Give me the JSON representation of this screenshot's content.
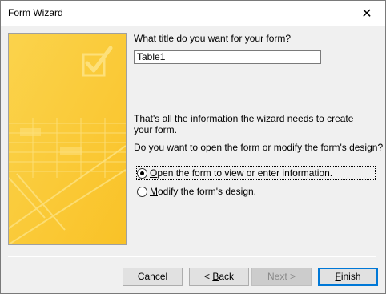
{
  "window": {
    "title": "Form Wizard",
    "close_label": "✕"
  },
  "form": {
    "question": "What title do you want for your form?",
    "title_value": "Table1",
    "info": "That's all the information the wizard needs to create your form.",
    "ask": "Do you want to open the form or modify the form's design?"
  },
  "options": [
    {
      "mnemonic": "O",
      "label_rest": "pen the form to view or enter information.",
      "selected": true
    },
    {
      "mnemonic": "M",
      "label_rest": "odify the form's design.",
      "selected": false
    }
  ],
  "buttons": {
    "cancel": "Cancel",
    "back_prefix": "< ",
    "back_mnemonic": "B",
    "back_rest": "ack",
    "next": "Next >",
    "finish_mnemonic": "F",
    "finish_rest": "inish"
  },
  "colors": {
    "art_yellow": "#fbc837",
    "art_light": "#fde07a",
    "accent": "#0078d7"
  }
}
